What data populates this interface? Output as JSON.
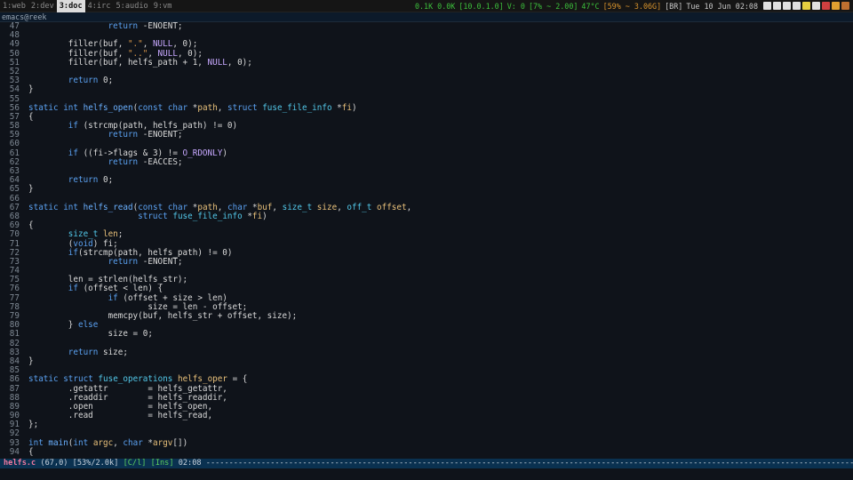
{
  "workspaces": [
    {
      "label": "1:web",
      "active": false
    },
    {
      "label": "2:dev",
      "active": false
    },
    {
      "label": "3:doc",
      "active": true
    },
    {
      "label": "4:irc",
      "active": false
    },
    {
      "label": "5:audio",
      "active": false
    },
    {
      "label": "9:vm",
      "active": false
    }
  ],
  "status": {
    "net": "0.1K 0.0K",
    "ip": "[10.0.1.0]",
    "vol": "V: 0",
    "cpu": "[7% ~ 2.00]",
    "temp": "47°C",
    "mem": "[59% ~ 3.06G]",
    "layout": "[BR]",
    "datetime": "Tue 10 Jun 02:08"
  },
  "tray_icons": [
    "printer-icon",
    "network-icon",
    "volume-icon",
    "update-icon",
    "mail-icon",
    "battery-icon",
    "clipboard-icon",
    "chrome-icon",
    "firefox-icon"
  ],
  "colors": {
    "tray": [
      "#e0e0e0",
      "#e0e0e0",
      "#e0e0e0",
      "#e0e0e0",
      "#e8d040",
      "#e0e0e0",
      "#d04040",
      "#e0a030",
      "#c07030"
    ]
  },
  "window_title": "emacs@reek",
  "code_lines": [
    {
      "n": "47",
      "t": "                return -ENOENT;"
    },
    {
      "n": "48",
      "t": ""
    },
    {
      "n": "49",
      "t": "        filler(buf, \".\", NULL, 0);"
    },
    {
      "n": "50",
      "t": "        filler(buf, \"..\", NULL, 0);"
    },
    {
      "n": "51",
      "t": "        filler(buf, helfs_path + 1, NULL, 0);"
    },
    {
      "n": "52",
      "t": ""
    },
    {
      "n": "53",
      "t": "        return 0;"
    },
    {
      "n": "54",
      "t": "}"
    },
    {
      "n": "55",
      "t": ""
    },
    {
      "n": "56",
      "t": "static int helfs_open(const char *path, struct fuse_file_info *fi)"
    },
    {
      "n": "57",
      "t": "{"
    },
    {
      "n": "58",
      "t": "        if (strcmp(path, helfs_path) != 0)"
    },
    {
      "n": "59",
      "t": "                return -ENOENT;"
    },
    {
      "n": "60",
      "t": ""
    },
    {
      "n": "61",
      "t": "        if ((fi->flags & 3) != O_RDONLY)"
    },
    {
      "n": "62",
      "t": "                return -EACCES;"
    },
    {
      "n": "63",
      "t": ""
    },
    {
      "n": "64",
      "t": "        return 0;"
    },
    {
      "n": "65",
      "t": "}"
    },
    {
      "n": "66",
      "t": ""
    },
    {
      "n": "67",
      "t": "static int helfs_read(const char *path, char *buf, size_t size, off_t offset,"
    },
    {
      "n": "68",
      "t": "                      struct fuse_file_info *fi)"
    },
    {
      "n": "69",
      "t": "{"
    },
    {
      "n": "70",
      "t": "        size_t len;"
    },
    {
      "n": "71",
      "t": "        (void) fi;"
    },
    {
      "n": "72",
      "t": "        if(strcmp(path, helfs_path) != 0)"
    },
    {
      "n": "73",
      "t": "                return -ENOENT;"
    },
    {
      "n": "74",
      "t": ""
    },
    {
      "n": "75",
      "t": "        len = strlen(helfs_str);"
    },
    {
      "n": "76",
      "t": "        if (offset < len) {"
    },
    {
      "n": "77",
      "t": "                if (offset + size > len)"
    },
    {
      "n": "78",
      "t": "                        size = len - offset;"
    },
    {
      "n": "79",
      "t": "                memcpy(buf, helfs_str + offset, size);"
    },
    {
      "n": "80",
      "t": "        } else"
    },
    {
      "n": "81",
      "t": "                size = 0;"
    },
    {
      "n": "82",
      "t": ""
    },
    {
      "n": "83",
      "t": "        return size;"
    },
    {
      "n": "84",
      "t": "}"
    },
    {
      "n": "85",
      "t": ""
    },
    {
      "n": "86",
      "t": "static struct fuse_operations helfs_oper = {"
    },
    {
      "n": "87",
      "t": "        .getattr        = helfs_getattr,"
    },
    {
      "n": "88",
      "t": "        .readdir        = helfs_readdir,"
    },
    {
      "n": "89",
      "t": "        .open           = helfs_open,"
    },
    {
      "n": "90",
      "t": "        .read           = helfs_read,"
    },
    {
      "n": "91",
      "t": "};"
    },
    {
      "n": "92",
      "t": ""
    },
    {
      "n": "93",
      "t": "int main(int argc, char *argv[])"
    },
    {
      "n": "94",
      "t": "{"
    }
  ],
  "modeline": {
    "file": "helfs.c",
    "position": "(67,0)",
    "size": "[53%/2.0k]",
    "mode": "[C/l]",
    "ins": "[Ins]",
    "time": "02:08",
    "dashes": "----------------------------------------------------------------------------------------------------------------------------------------------------------------"
  }
}
